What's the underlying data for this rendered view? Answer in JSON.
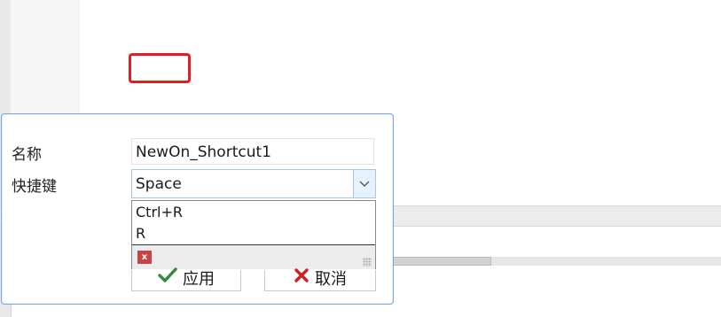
{
  "form": {
    "name_label": "名称",
    "name_value": "NewOn_Shortcut1",
    "shortcut_label": "快捷键",
    "shortcut_value": "Space"
  },
  "dropdown": {
    "options": [
      "Ctrl+R",
      "R"
    ],
    "clear_icon": "x"
  },
  "buttons": {
    "apply_label": "应用",
    "cancel_label": "取消"
  },
  "colors": {
    "highlight": "#e31e1e",
    "apply_check": "#2e8b3a",
    "cancel_x": "#d11f1f",
    "dialog_border": "#7aa7d6"
  },
  "icons": {
    "dropdown_arrow": "chevron-down-icon",
    "apply": "check-icon",
    "cancel": "close-icon"
  }
}
